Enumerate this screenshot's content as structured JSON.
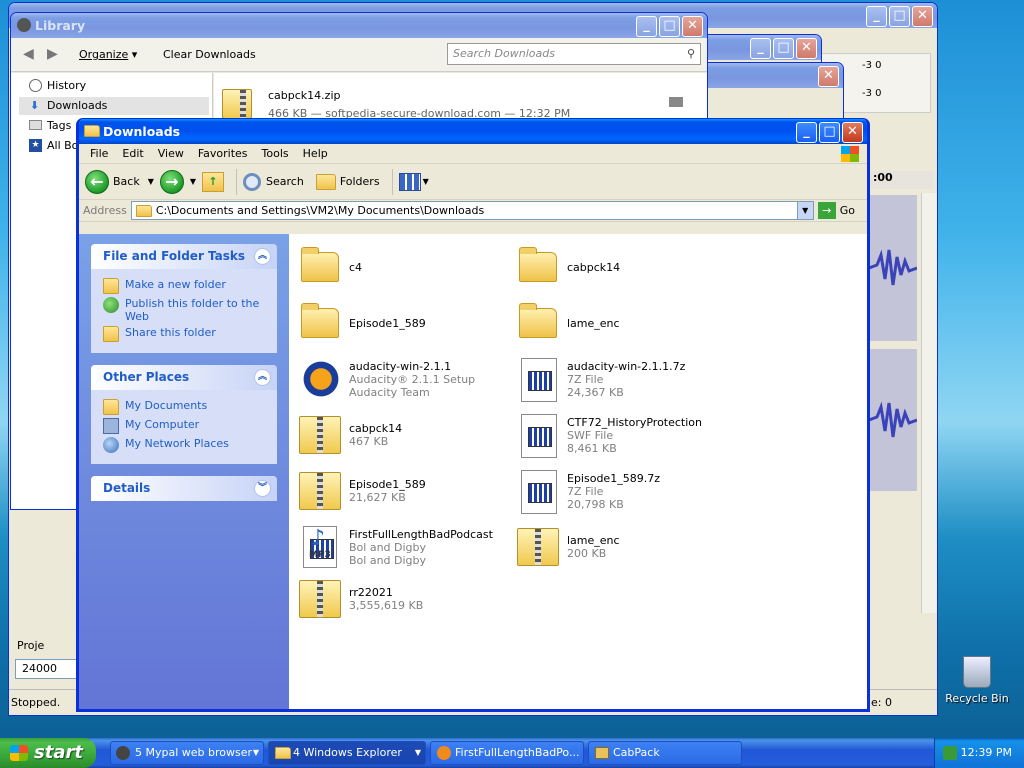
{
  "library": {
    "title": "Library",
    "organize": "Organize",
    "clear_downloads": "Clear Downloads",
    "search_placeholder": "Search Downloads",
    "nav": [
      "History",
      "Downloads",
      "Tags",
      "All Bo"
    ],
    "download": {
      "name": "cabpck14.zip",
      "meta": "466 KB — softpedia-secure-download.com — 12:32 PM"
    }
  },
  "audacity_bg": {
    "db1": "-3  0",
    "db2": "-3  0",
    "timeline": ":00",
    "project_label": "Proje",
    "project_rate": "24000",
    "status": "Stopped.",
    "status_right": "e: 0"
  },
  "explorer": {
    "title": "Downloads",
    "menu": [
      "File",
      "Edit",
      "View",
      "Favorites",
      "Tools",
      "Help"
    ],
    "toolbar": {
      "back": "Back",
      "search": "Search",
      "folders": "Folders"
    },
    "address_label": "Address",
    "address_value": "C:\\Documents and Settings\\VM2\\My Documents\\Downloads",
    "go": "Go",
    "file_tasks": {
      "title": "File and Folder Tasks",
      "items": [
        "Make a new folder",
        "Publish this folder to the Web",
        "Share this folder"
      ]
    },
    "other_places": {
      "title": "Other Places",
      "items": [
        "My Documents",
        "My Computer",
        "My Network Places"
      ]
    },
    "details": {
      "title": "Details"
    },
    "files": [
      {
        "name": "c4",
        "l2": "",
        "l3": "",
        "icon": "folder-icon"
      },
      {
        "name": "cabpck14",
        "l2": "",
        "l3": "",
        "icon": "folder-icon"
      },
      {
        "name": "Episode1_589",
        "l2": "",
        "l3": "",
        "icon": "folder-icon"
      },
      {
        "name": "lame_enc",
        "l2": "",
        "l3": "",
        "icon": "folder-icon"
      },
      {
        "name": "audacity-win-2.1.1",
        "l2": "Audacity® 2.1.1 Setup",
        "l3": "Audacity Team",
        "icon": "audacity-headphones-icon"
      },
      {
        "name": "audacity-win-2.1.1.7z",
        "l2": "7Z File",
        "l3": "24,367 KB",
        "icon": "generic-file-icon"
      },
      {
        "name": "cabpck14",
        "l2": "467 KB",
        "l3": "",
        "icon": "zip-folder-icon"
      },
      {
        "name": "CTF72_HistoryProtection",
        "l2": "SWF File",
        "l3": "8,461 KB",
        "icon": "generic-file-icon"
      },
      {
        "name": "Episode1_589",
        "l2": "21,627 KB",
        "l3": "",
        "icon": "zip-folder-icon"
      },
      {
        "name": "Episode1_589.7z",
        "l2": "7Z File",
        "l3": "20,798 KB",
        "icon": "generic-file-icon"
      },
      {
        "name": "FirstFullLengthBadPodcast",
        "l2": "Bol and Digby",
        "l3": "Bol and Digby",
        "icon": "mp3-file-icon"
      },
      {
        "name": "lame_enc",
        "l2": "200 KB",
        "l3": "",
        "icon": "zip-folder-icon"
      },
      {
        "name": "rr22021",
        "l2": "3,555,619 KB",
        "l3": "",
        "icon": "zip-folder-icon"
      }
    ],
    "mp3_badge": "MP3"
  },
  "desktop": {
    "recycle_bin": "Recycle Bin"
  },
  "taskbar": {
    "start": "start",
    "tasks": [
      "5 Mypal web browser",
      "4 Windows Explorer",
      "FirstFullLengthBadPo...",
      "CabPack"
    ],
    "clock": "12:39 PM"
  }
}
